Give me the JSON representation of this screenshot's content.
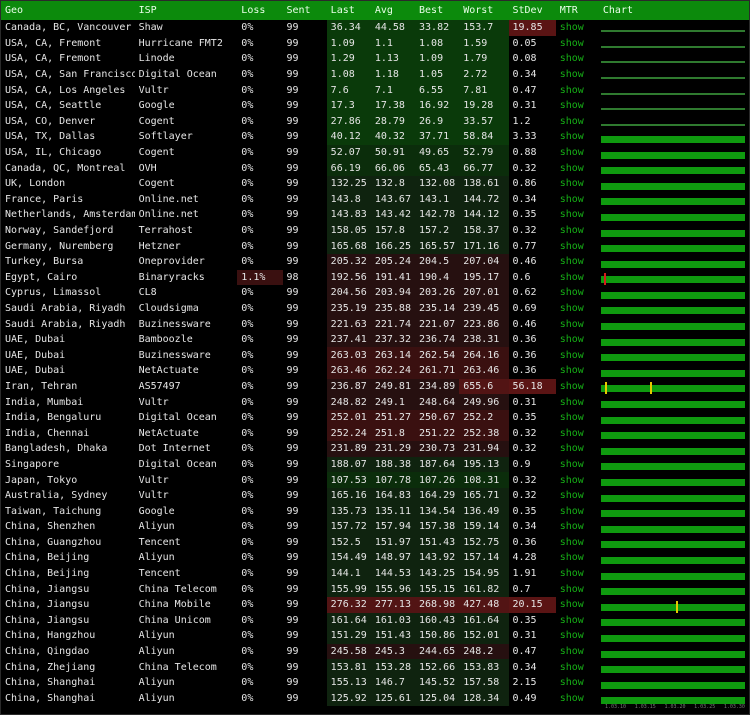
{
  "headers": [
    "Geo",
    "ISP",
    "Loss",
    "Sent",
    "Last",
    "Avg",
    "Best",
    "Worst",
    "StDev",
    "MTR",
    "Chart"
  ],
  "mtr_link": "show",
  "axis_ticks": [
    "1.03.10",
    "1.03.15",
    "1.03.20",
    "1.03.25",
    "1.03.30"
  ],
  "rows": [
    {
      "geo": "Canada, BC, Vancouver",
      "isp": "Shaw",
      "loss": "0%",
      "sent": "99",
      "last": "36.34",
      "avg": "44.58",
      "best": "33.82",
      "worst": "153.7",
      "stdev": "19.85",
      "chart": "base",
      "tone": "g3",
      "std_hi": true
    },
    {
      "geo": "USA, CA, Fremont",
      "isp": "Hurricane FMT2",
      "loss": "0%",
      "sent": "99",
      "last": "1.09",
      "avg": "1.1",
      "best": "1.08",
      "worst": "1.59",
      "stdev": "0.05",
      "chart": "base",
      "tone": "g3"
    },
    {
      "geo": "USA, CA, Fremont",
      "isp": "Linode",
      "loss": "0%",
      "sent": "99",
      "last": "1.29",
      "avg": "1.13",
      "best": "1.09",
      "worst": "1.79",
      "stdev": "0.08",
      "chart": "base",
      "tone": "g3"
    },
    {
      "geo": "USA, CA, San Francisco",
      "isp": "Digital Ocean",
      "loss": "0%",
      "sent": "99",
      "last": "1.08",
      "avg": "1.18",
      "best": "1.05",
      "worst": "2.72",
      "stdev": "0.34",
      "chart": "base",
      "tone": "g3"
    },
    {
      "geo": "USA, CA, Los Angeles",
      "isp": "Vultr",
      "loss": "0%",
      "sent": "99",
      "last": "7.6",
      "avg": "7.1",
      "best": "6.55",
      "worst": "7.81",
      "stdev": "0.47",
      "chart": "base",
      "tone": "g3"
    },
    {
      "geo": "USA, CA, Seattle",
      "isp": "Google",
      "loss": "0%",
      "sent": "99",
      "last": "17.3",
      "avg": "17.38",
      "best": "16.92",
      "worst": "19.28",
      "stdev": "0.31",
      "chart": "base",
      "tone": "g3"
    },
    {
      "geo": "USA, CO, Denver",
      "isp": "Cogent",
      "loss": "0%",
      "sent": "99",
      "last": "27.86",
      "avg": "28.79",
      "best": "26.9",
      "worst": "33.57",
      "stdev": "1.2",
      "chart": "base",
      "tone": "g3"
    },
    {
      "geo": "USA, TX, Dallas",
      "isp": "Softlayer",
      "loss": "0%",
      "sent": "99",
      "last": "40.12",
      "avg": "40.32",
      "best": "37.71",
      "worst": "58.84",
      "stdev": "3.33",
      "chart": "bar",
      "tone": "g3"
    },
    {
      "geo": "USA, IL, Chicago",
      "isp": "Cogent",
      "loss": "0%",
      "sent": "99",
      "last": "52.07",
      "avg": "50.91",
      "best": "49.65",
      "worst": "52.79",
      "stdev": "0.88",
      "chart": "bar",
      "tone": "g2"
    },
    {
      "geo": "Canada, QC, Montreal",
      "isp": "OVH",
      "loss": "0%",
      "sent": "99",
      "last": "66.19",
      "avg": "66.06",
      "best": "65.43",
      "worst": "66.77",
      "stdev": "0.32",
      "chart": "bar",
      "tone": "g2"
    },
    {
      "geo": "UK, London",
      "isp": "Cogent",
      "loss": "0%",
      "sent": "99",
      "last": "132.25",
      "avg": "132.8",
      "best": "132.08",
      "worst": "138.61",
      "stdev": "0.86",
      "chart": "bar",
      "tone": "g1"
    },
    {
      "geo": "France, Paris",
      "isp": "Online.net",
      "loss": "0%",
      "sent": "99",
      "last": "143.8",
      "avg": "143.67",
      "best": "143.1",
      "worst": "144.72",
      "stdev": "0.34",
      "chart": "bar",
      "tone": "g1"
    },
    {
      "geo": "Netherlands, Amsterdam",
      "isp": "Online.net",
      "loss": "0%",
      "sent": "99",
      "last": "143.83",
      "avg": "143.42",
      "best": "142.78",
      "worst": "144.12",
      "stdev": "0.35",
      "chart": "bar",
      "tone": "g1"
    },
    {
      "geo": "Norway, Sandefjord",
      "isp": "Terrahost",
      "loss": "0%",
      "sent": "99",
      "last": "158.05",
      "avg": "157.8",
      "best": "157.2",
      "worst": "158.37",
      "stdev": "0.32",
      "chart": "bar",
      "tone": "g1"
    },
    {
      "geo": "Germany, Nuremberg",
      "isp": "Hetzner",
      "loss": "0%",
      "sent": "99",
      "last": "165.68",
      "avg": "166.25",
      "best": "165.57",
      "worst": "171.16",
      "stdev": "0.77",
      "chart": "bar",
      "tone": "g1"
    },
    {
      "geo": "Turkey, Bursa",
      "isp": "Oneprovider",
      "loss": "0%",
      "sent": "99",
      "last": "205.32",
      "avg": "205.24",
      "best": "204.5",
      "worst": "207.04",
      "stdev": "0.46",
      "chart": "bar",
      "tone": "r1"
    },
    {
      "geo": "Egypt, Cairo",
      "isp": "Binaryracks",
      "loss": "1.1%",
      "sent": "98",
      "last": "192.56",
      "avg": "191.41",
      "best": "190.4",
      "worst": "195.17",
      "stdev": "0.6",
      "chart": "bar",
      "tone": "r1",
      "loss_hi": true,
      "marks": [
        {
          "pos": 0.02,
          "c": "red"
        }
      ]
    },
    {
      "geo": "Cyprus, Limassol",
      "isp": "CL8",
      "loss": "0%",
      "sent": "99",
      "last": "204.56",
      "avg": "203.94",
      "best": "203.26",
      "worst": "207.01",
      "stdev": "0.62",
      "chart": "bar",
      "tone": "r1"
    },
    {
      "geo": "Saudi Arabia, Riyadh",
      "isp": "Cloudsigma",
      "loss": "0%",
      "sent": "99",
      "last": "235.19",
      "avg": "235.88",
      "best": "235.14",
      "worst": "239.45",
      "stdev": "0.69",
      "chart": "bar",
      "tone": "r1"
    },
    {
      "geo": "Saudi Arabia, Riyadh",
      "isp": "Buzinessware",
      "loss": "0%",
      "sent": "99",
      "last": "221.63",
      "avg": "221.74",
      "best": "221.07",
      "worst": "223.86",
      "stdev": "0.46",
      "chart": "bar",
      "tone": "r1"
    },
    {
      "geo": "UAE, Dubai",
      "isp": "Bamboozle",
      "loss": "0%",
      "sent": "99",
      "last": "237.41",
      "avg": "237.32",
      "best": "236.74",
      "worst": "238.31",
      "stdev": "0.36",
      "chart": "bar",
      "tone": "r1"
    },
    {
      "geo": "UAE, Dubai",
      "isp": "Buzinessware",
      "loss": "0%",
      "sent": "99",
      "last": "263.03",
      "avg": "263.14",
      "best": "262.54",
      "worst": "264.16",
      "stdev": "0.36",
      "chart": "bar",
      "tone": "r2"
    },
    {
      "geo": "UAE, Dubai",
      "isp": "NetActuate",
      "loss": "0%",
      "sent": "99",
      "last": "263.46",
      "avg": "262.24",
      "best": "261.71",
      "worst": "263.46",
      "stdev": "0.36",
      "chart": "bar",
      "tone": "r2"
    },
    {
      "geo": "Iran, Tehran",
      "isp": "AS57497",
      "loss": "0%",
      "sent": "99",
      "last": "236.87",
      "avg": "249.81",
      "best": "234.89",
      "worst": "655.6",
      "stdev": "56.18",
      "chart": "bar",
      "tone": "r1",
      "worst_hi": true,
      "std_hi": true,
      "marks": [
        {
          "pos": 0.03,
          "c": "yel"
        },
        {
          "pos": 0.34,
          "c": "yel"
        }
      ]
    },
    {
      "geo": "India, Mumbai",
      "isp": "Vultr",
      "loss": "0%",
      "sent": "99",
      "last": "248.82",
      "avg": "249.1",
      "best": "248.64",
      "worst": "249.96",
      "stdev": "0.31",
      "chart": "bar",
      "tone": "r1"
    },
    {
      "geo": "India, Bengaluru",
      "isp": "Digital Ocean",
      "loss": "0%",
      "sent": "99",
      "last": "252.01",
      "avg": "251.27",
      "best": "250.67",
      "worst": "252.2",
      "stdev": "0.35",
      "chart": "bar",
      "tone": "r2"
    },
    {
      "geo": "India, Chennai",
      "isp": "NetActuate",
      "loss": "0%",
      "sent": "99",
      "last": "252.24",
      "avg": "251.8",
      "best": "251.22",
      "worst": "252.38",
      "stdev": "0.32",
      "chart": "bar",
      "tone": "r2"
    },
    {
      "geo": "Bangladesh, Dhaka",
      "isp": "Dot Internet",
      "loss": "0%",
      "sent": "99",
      "last": "231.89",
      "avg": "231.29",
      "best": "230.73",
      "worst": "231.94",
      "stdev": "0.32",
      "chart": "bar",
      "tone": "r1"
    },
    {
      "geo": "Singapore",
      "isp": "Digital Ocean",
      "loss": "0%",
      "sent": "99",
      "last": "188.07",
      "avg": "188.38",
      "best": "187.64",
      "worst": "195.13",
      "stdev": "0.9",
      "chart": "bar",
      "tone": "g1"
    },
    {
      "geo": "Japan, Tokyo",
      "isp": "Vultr",
      "loss": "0%",
      "sent": "99",
      "last": "107.53",
      "avg": "107.78",
      "best": "107.26",
      "worst": "108.31",
      "stdev": "0.32",
      "chart": "bar",
      "tone": "g2"
    },
    {
      "geo": "Australia, Sydney",
      "isp": "Vultr",
      "loss": "0%",
      "sent": "99",
      "last": "165.16",
      "avg": "164.83",
      "best": "164.29",
      "worst": "165.71",
      "stdev": "0.32",
      "chart": "bar",
      "tone": "g1"
    },
    {
      "geo": "Taiwan, Taichung",
      "isp": "Google",
      "loss": "0%",
      "sent": "99",
      "last": "135.73",
      "avg": "135.11",
      "best": "134.54",
      "worst": "136.49",
      "stdev": "0.35",
      "chart": "bar",
      "tone": "g1"
    },
    {
      "geo": "China, Shenzhen",
      "isp": "Aliyun",
      "loss": "0%",
      "sent": "99",
      "last": "157.72",
      "avg": "157.94",
      "best": "157.38",
      "worst": "159.14",
      "stdev": "0.34",
      "chart": "bar",
      "tone": "g1"
    },
    {
      "geo": "China, Guangzhou",
      "isp": "Tencent",
      "loss": "0%",
      "sent": "99",
      "last": "152.5",
      "avg": "151.97",
      "best": "151.43",
      "worst": "152.75",
      "stdev": "0.36",
      "chart": "bar",
      "tone": "g1"
    },
    {
      "geo": "China, Beijing",
      "isp": "Aliyun",
      "loss": "0%",
      "sent": "99",
      "last": "154.49",
      "avg": "148.97",
      "best": "143.92",
      "worst": "157.14",
      "stdev": "4.28",
      "chart": "bar",
      "tone": "g1"
    },
    {
      "geo": "China, Beijing",
      "isp": "Tencent",
      "loss": "0%",
      "sent": "99",
      "last": "144.1",
      "avg": "144.53",
      "best": "143.25",
      "worst": "154.95",
      "stdev": "1.91",
      "chart": "bar",
      "tone": "g1"
    },
    {
      "geo": "China, Jiangsu",
      "isp": "China Telecom",
      "loss": "0%",
      "sent": "99",
      "last": "155.99",
      "avg": "155.96",
      "best": "155.15",
      "worst": "161.82",
      "stdev": "0.7",
      "chart": "bar",
      "tone": "g1"
    },
    {
      "geo": "China, Jiangsu",
      "isp": "China Mobile",
      "loss": "0%",
      "sent": "99",
      "last": "276.32",
      "avg": "277.13",
      "best": "268.98",
      "worst": "427.48",
      "stdev": "20.15",
      "chart": "bar",
      "tone": "r3",
      "worst_hi": true,
      "std_hi": true,
      "marks": [
        {
          "pos": 0.52,
          "c": "yel"
        }
      ]
    },
    {
      "geo": "China, Jiangsu",
      "isp": "China Unicom",
      "loss": "0%",
      "sent": "99",
      "last": "161.64",
      "avg": "161.03",
      "best": "160.43",
      "worst": "161.64",
      "stdev": "0.35",
      "chart": "bar",
      "tone": "g1"
    },
    {
      "geo": "China, Hangzhou",
      "isp": "Aliyun",
      "loss": "0%",
      "sent": "99",
      "last": "151.29",
      "avg": "151.43",
      "best": "150.86",
      "worst": "152.01",
      "stdev": "0.31",
      "chart": "bar",
      "tone": "g1"
    },
    {
      "geo": "China, Qingdao",
      "isp": "Aliyun",
      "loss": "0%",
      "sent": "99",
      "last": "245.58",
      "avg": "245.3",
      "best": "244.65",
      "worst": "248.2",
      "stdev": "0.47",
      "chart": "bar",
      "tone": "r1"
    },
    {
      "geo": "China, Zhejiang",
      "isp": "China Telecom",
      "loss": "0%",
      "sent": "99",
      "last": "153.81",
      "avg": "153.28",
      "best": "152.66",
      "worst": "153.83",
      "stdev": "0.34",
      "chart": "bar",
      "tone": "g1"
    },
    {
      "geo": "China, Shanghai",
      "isp": "Aliyun",
      "loss": "0%",
      "sent": "99",
      "last": "155.13",
      "avg": "146.7",
      "best": "145.52",
      "worst": "157.58",
      "stdev": "2.15",
      "chart": "bar",
      "tone": "g1"
    },
    {
      "geo": "China, Shanghai",
      "isp": "Aliyun",
      "loss": "0%",
      "sent": "99",
      "last": "125.92",
      "avg": "125.61",
      "best": "125.04",
      "worst": "128.34",
      "stdev": "0.49",
      "chart": "bar",
      "tone": "g1"
    }
  ]
}
